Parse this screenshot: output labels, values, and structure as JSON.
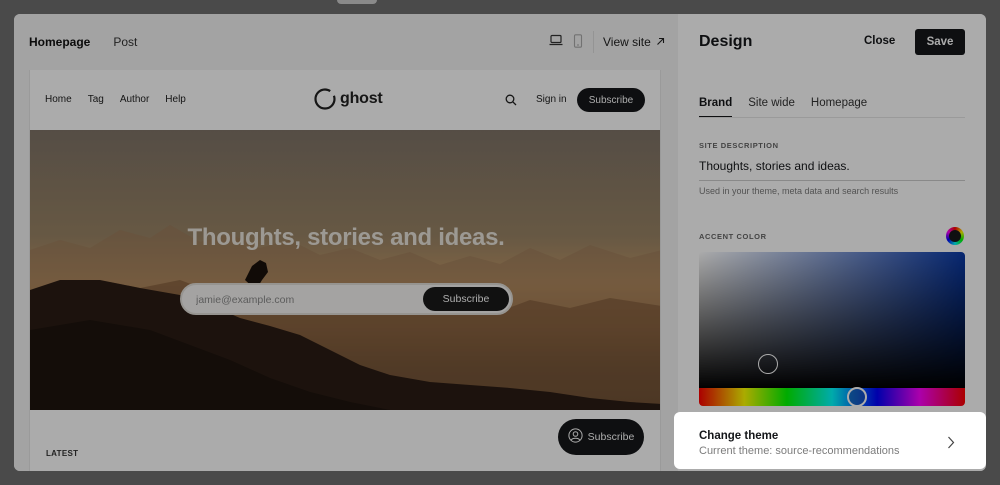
{
  "preview": {
    "tabs": [
      {
        "label": "Homepage"
      },
      {
        "label": "Post"
      }
    ],
    "view_site_label": "View site",
    "site": {
      "nav_links": [
        "Home",
        "Tag",
        "Author",
        "Help"
      ],
      "logo_text": "ghost",
      "signin_label": "Sign in",
      "subscribe_label": "Subscribe",
      "hero_title": "Thoughts, stories and ideas.",
      "email_placeholder": "jamie@example.com",
      "hero_button_label": "Subscribe",
      "latest_label": "LATEST",
      "portal_button_label": "Subscribe"
    }
  },
  "panel": {
    "title": "Design",
    "close_label": "Close",
    "save_label": "Save",
    "tabs": [
      "Brand",
      "Site wide",
      "Homepage"
    ],
    "site_description_label": "SITE DESCRIPTION",
    "site_description_value": "Thoughts, stories and ideas.",
    "site_description_hint": "Used in your theme, meta data and search results",
    "accent_color_label": "ACCENT COLOR",
    "accent_color": "#15171a"
  },
  "theme": {
    "title": "Change theme",
    "current": "Current theme: source-recommendations"
  }
}
